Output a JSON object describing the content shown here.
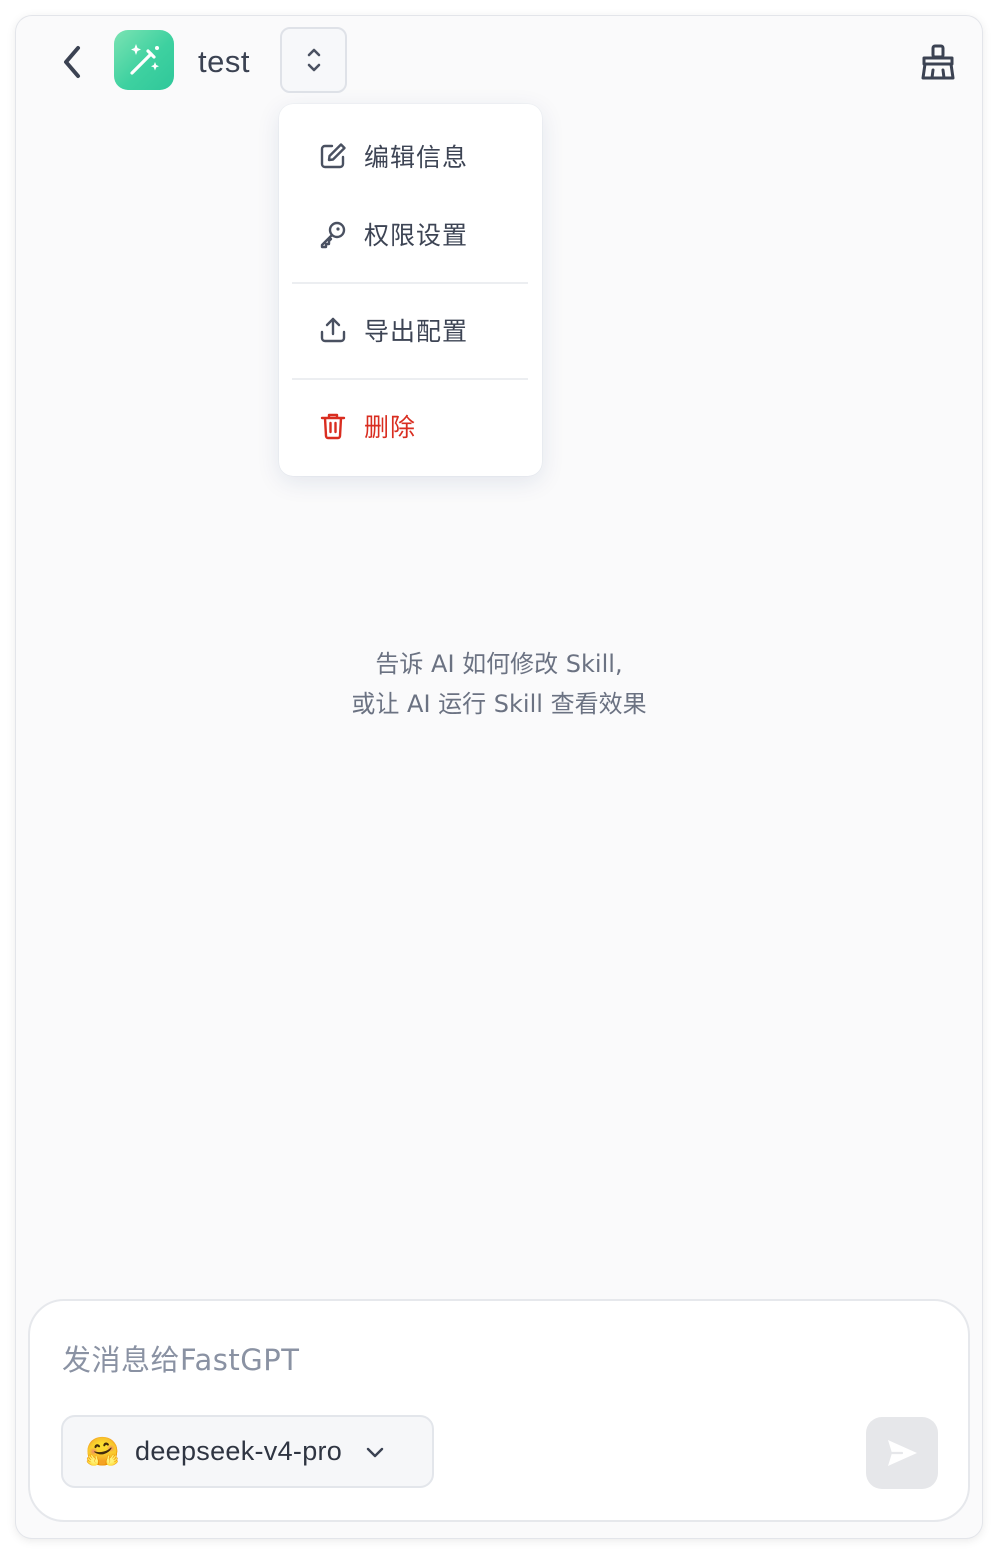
{
  "header": {
    "title": "test",
    "back_icon": "chevron-left-icon",
    "app_icon": "magic-wand-icon",
    "switch_icon": "chevron-up-down-icon",
    "clear_icon": "broom-icon",
    "app_icon_colors": [
      "#7be3b3",
      "#2fc79a"
    ]
  },
  "menu": {
    "items": [
      {
        "label": "编辑信息",
        "icon": "edit-icon"
      },
      {
        "label": "权限设置",
        "icon": "key-icon"
      },
      {
        "label": "导出配置",
        "icon": "upload-icon"
      },
      {
        "label": "删除",
        "icon": "trash-icon",
        "danger": true
      }
    ],
    "danger_color": "#d92d20"
  },
  "empty_tip": {
    "line1": "告诉 AI 如何修改 Skill,",
    "line2": "或让 AI 运行 Skill 查看效果"
  },
  "composer": {
    "placeholder": "发消息给FastGPT",
    "model": {
      "emoji": "🤗",
      "name": "deepseek-v4-pro",
      "chevron_icon": "chevron-down-icon"
    },
    "send_icon": "send-icon"
  }
}
